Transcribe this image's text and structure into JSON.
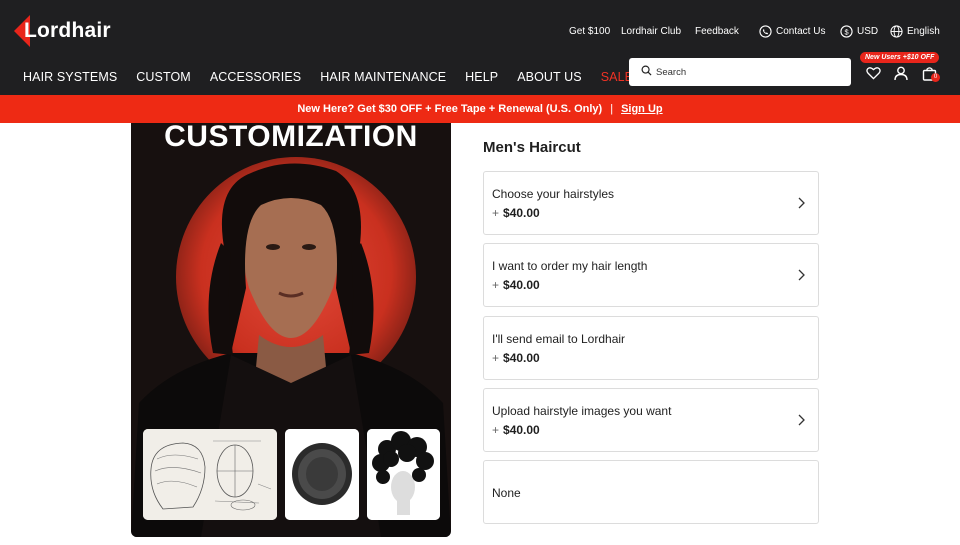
{
  "header": {
    "logo": "Lordhair",
    "util_links": [
      "Get $100",
      "Lordhair Club",
      "Feedback"
    ],
    "contact": "Contact Us",
    "currency": "USD",
    "language": "English",
    "nav": [
      "HAIR SYSTEMS",
      "CUSTOM",
      "ACCESSORIES",
      "HAIR MAINTENANCE",
      "HELP",
      "ABOUT US",
      "SALE"
    ],
    "search_placeholder": "Search",
    "promo_pill": "New Users +$10 OFF",
    "cart_count": "0"
  },
  "banner": {
    "text": "New Here? Get $30 OFF + Free Tape + Renewal (U.S. Only)",
    "separator": "|",
    "link": "Sign Up"
  },
  "hero": {
    "title": "CUSTOMIZATION"
  },
  "options": {
    "title": "Men's Haircut",
    "items": [
      {
        "label": "Choose your hairstyles",
        "plus": "+",
        "price": "$40.00"
      },
      {
        "label": "I want to order my hair length",
        "plus": "+",
        "price": "$40.00"
      },
      {
        "label": "I'll send email to Lordhair",
        "plus": "+",
        "price": "$40.00"
      },
      {
        "label": "Upload hairstyle images you want",
        "plus": "+",
        "price": "$40.00"
      },
      {
        "label": "None"
      }
    ]
  },
  "colors": {
    "header_bg": "#1f1f21",
    "accent": "#ee2a14",
    "sale": "#ee3224"
  }
}
